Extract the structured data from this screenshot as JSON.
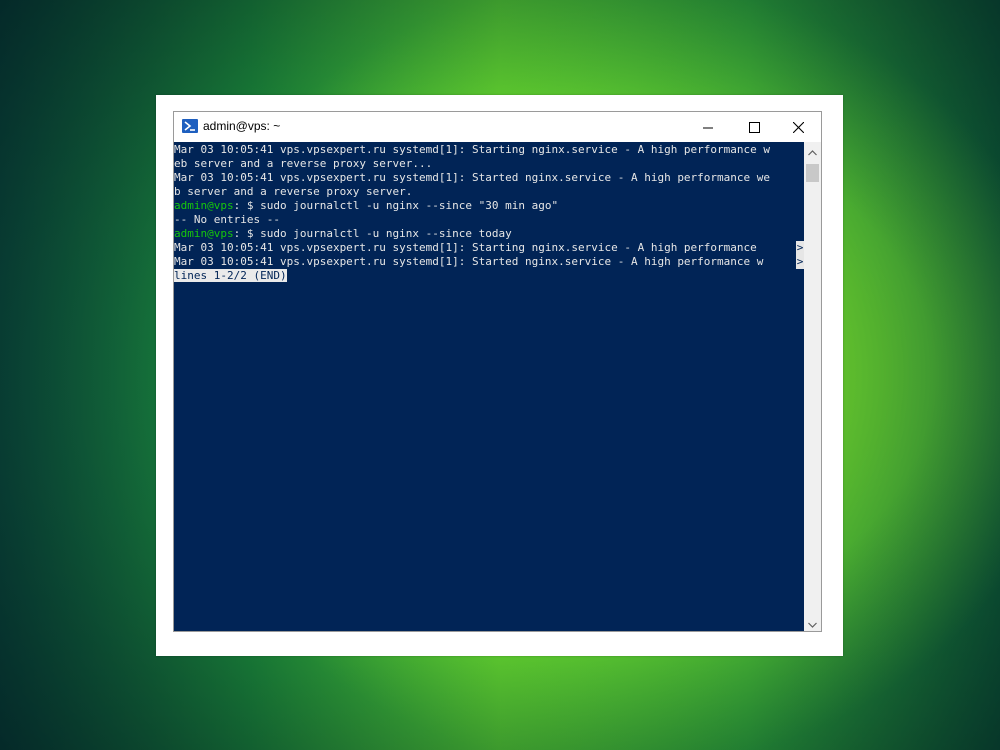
{
  "window": {
    "title": "admin@vps: ~",
    "icon": "powershell-icon",
    "buttons": {
      "minimize": "minimize-icon",
      "maximize": "maximize-icon",
      "close": "close-icon"
    }
  },
  "terminal": {
    "lines": [
      "Mar 03 10:05:41 vps.vpsexpert.ru systemd[1]: Starting nginx.service - A high performance w",
      "eb server and a reverse proxy server...",
      "Mar 03 10:05:41 vps.vpsexpert.ru systemd[1]: Started nginx.service - A high performance we",
      "b server and a reverse proxy server."
    ],
    "prompt1_user": "admin@vps",
    "prompt1_rest": ": $ sudo journalctl -u nginx --since \"30 min ago\"",
    "no_entries": "-- No entries --",
    "prompt2_user": "admin@vps",
    "prompt2_rest": ": $ sudo journalctl -u nginx --since today",
    "pager_lines": [
      "Mar 03 10:05:41 vps.vpsexpert.ru systemd[1]: Starting nginx.service - A high performance ",
      "Mar 03 10:05:41 vps.vpsexpert.ru systemd[1]: Started nginx.service - A high performance w"
    ],
    "truncation_marker": ">",
    "pager_status": "lines 1-2/2 (END)"
  },
  "colors": {
    "terminal_bg": "#012456",
    "prompt_user": "#16c60c",
    "text": "#e6e6e6"
  }
}
